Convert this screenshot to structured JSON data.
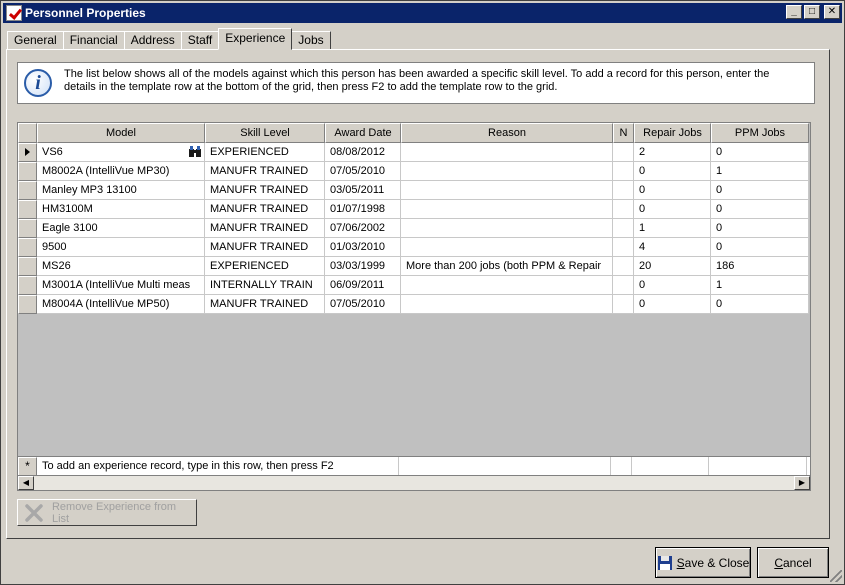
{
  "window": {
    "title": "Personnel Properties"
  },
  "tabs": [
    {
      "label": "General"
    },
    {
      "label": "Financial"
    },
    {
      "label": "Address"
    },
    {
      "label": "Staff"
    },
    {
      "label": "Experience",
      "active": true
    },
    {
      "label": "Jobs"
    }
  ],
  "info": {
    "icon": "info-icon",
    "text": "The list below shows all of the models against which this person has been awarded a specific skill level. To add a record for this person, enter the details in the template row at the bottom of the grid, then press F2 to add the template row to the grid."
  },
  "grid": {
    "columns": [
      "Model",
      "Skill Level",
      "Award Date",
      "Reason",
      "N",
      "Repair Jobs",
      "PPM Jobs"
    ],
    "rows": [
      {
        "model": "VS6",
        "skill": "EXPERIENCED",
        "date": "08/08/2012",
        "reason": "",
        "n": "",
        "repair": "2",
        "ppm": "0"
      },
      {
        "model": "M8002A (IntelliVue MP30)",
        "skill": "MANUFR TRAINED",
        "date": "07/05/2010",
        "reason": "",
        "n": "",
        "repair": "0",
        "ppm": "1"
      },
      {
        "model": "Manley MP3 13100",
        "skill": "MANUFR TRAINED",
        "date": "03/05/2011",
        "reason": "",
        "n": "",
        "repair": "0",
        "ppm": "0"
      },
      {
        "model": "HM3100M",
        "skill": "MANUFR TRAINED",
        "date": "01/07/1998",
        "reason": "",
        "n": "",
        "repair": "0",
        "ppm": "0"
      },
      {
        "model": "Eagle 3100",
        "skill": "MANUFR TRAINED",
        "date": "07/06/2002",
        "reason": "",
        "n": "",
        "repair": "1",
        "ppm": "0"
      },
      {
        "model": "9500",
        "skill": "MANUFR TRAINED",
        "date": "01/03/2010",
        "reason": "",
        "n": "",
        "repair": "4",
        "ppm": "0"
      },
      {
        "model": "MS26",
        "skill": "EXPERIENCED",
        "date": "03/03/1999",
        "reason": "More than 200 jobs (both PPM & Repair",
        "n": "",
        "repair": "20",
        "ppm": "186"
      },
      {
        "model": "M3001A (IntelliVue Multi meas",
        "skill": "INTERNALLY TRAIN",
        "date": "06/09/2011",
        "reason": "",
        "n": "",
        "repair": "0",
        "ppm": "1"
      },
      {
        "model": "M8004A (IntelliVue MP50)",
        "skill": "MANUFR TRAINED",
        "date": "07/05/2010",
        "reason": "",
        "n": "",
        "repair": "0",
        "ppm": "0"
      }
    ],
    "template_row_text": "To add an experience record, type in this row, then press F2",
    "template_marker": "*"
  },
  "buttons": {
    "remove": "Remove Experience from List",
    "save_prefix": "S",
    "save_rest": "ave & Close",
    "cancel_prefix": "C",
    "cancel_rest": "ancel"
  },
  "icons": {
    "lookup": "binoculars-icon",
    "remove": "x-icon",
    "save": "floppy-disk-icon"
  }
}
